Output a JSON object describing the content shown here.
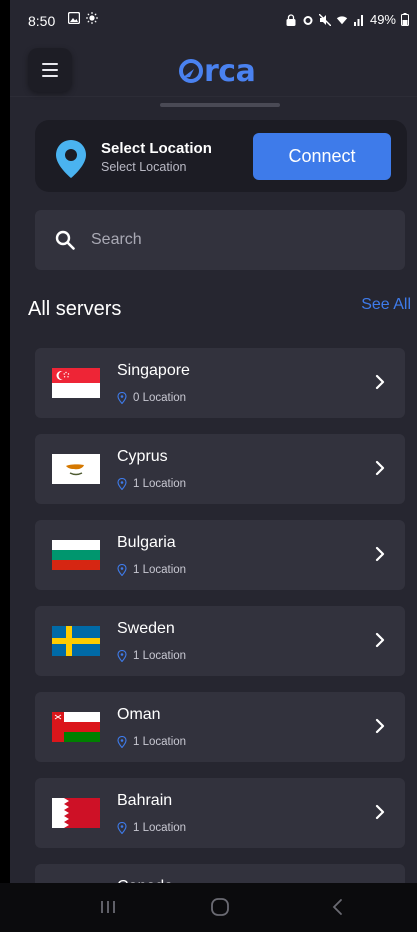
{
  "status_bar": {
    "time": "8:50",
    "battery": "49%"
  },
  "app": {
    "logo_text": "rca"
  },
  "location_card": {
    "title": "Select Location",
    "subtitle": "Select Location",
    "connect_label": "Connect",
    "pin_color": "#4ab3f0"
  },
  "search": {
    "placeholder": "Search"
  },
  "servers_section": {
    "title": "All servers",
    "see_all_label": "See All"
  },
  "servers": [
    {
      "name": "Singapore",
      "locations": "0 Location",
      "flag": "sg"
    },
    {
      "name": "Cyprus",
      "locations": "1 Location",
      "flag": "cy"
    },
    {
      "name": "Bulgaria",
      "locations": "1 Location",
      "flag": "bg"
    },
    {
      "name": "Sweden",
      "locations": "1 Location",
      "flag": "se"
    },
    {
      "name": "Oman",
      "locations": "1 Location",
      "flag": "om"
    },
    {
      "name": "Bahrain",
      "locations": "1 Location",
      "flag": "bh"
    },
    {
      "name": "Canada",
      "locations": "",
      "flag": "ca"
    }
  ],
  "colors": {
    "accent": "#3e7bea",
    "background": "#262630",
    "card": "#32323d"
  }
}
